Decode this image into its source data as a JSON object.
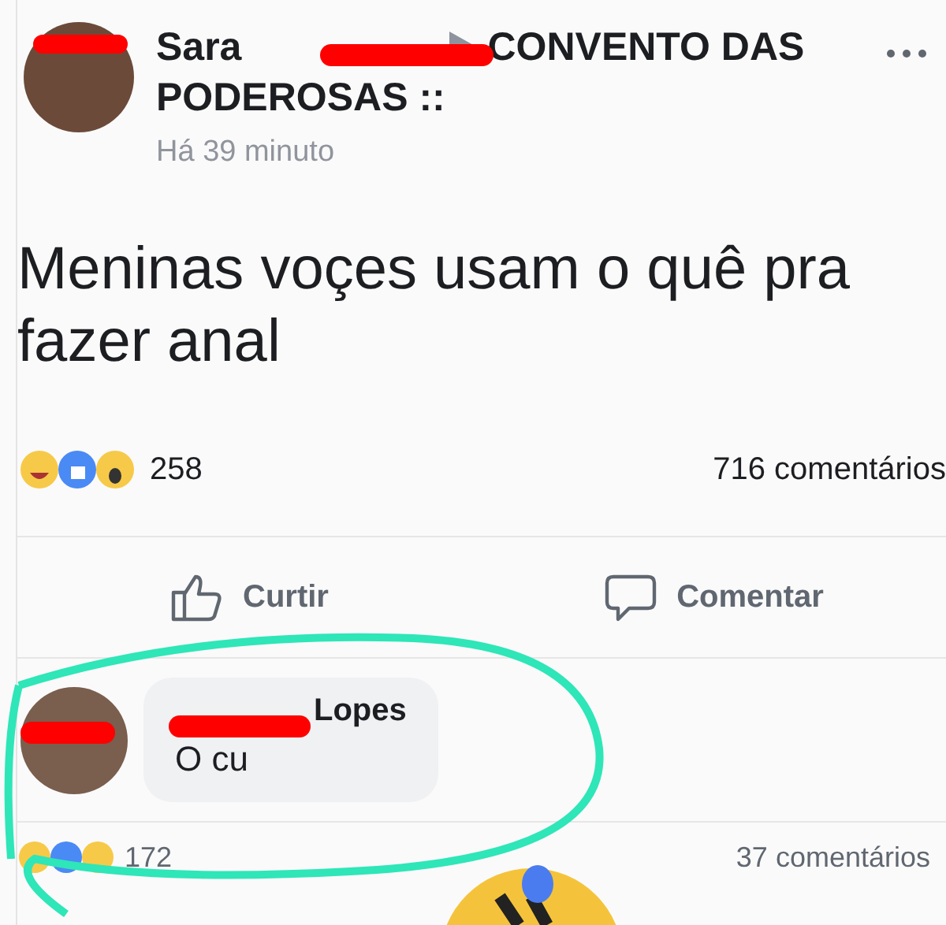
{
  "post": {
    "author": "Sara",
    "group_lines": [
      "CONVENTO DAS",
      "PODEROSAS ::"
    ],
    "time": "Há 39 minuto",
    "text": "Meninas voçes usam  o quê pra fazer anal",
    "reaction_count": "258",
    "comment_count": "716 comentários"
  },
  "actions": [
    {
      "kind": "like",
      "label": "Curtir"
    },
    {
      "kind": "comment",
      "label": "Comentar"
    }
  ],
  "comment": {
    "author": "Lopes",
    "text": "O cu",
    "reaction_count": "172",
    "comment_count": "37 comentários"
  }
}
